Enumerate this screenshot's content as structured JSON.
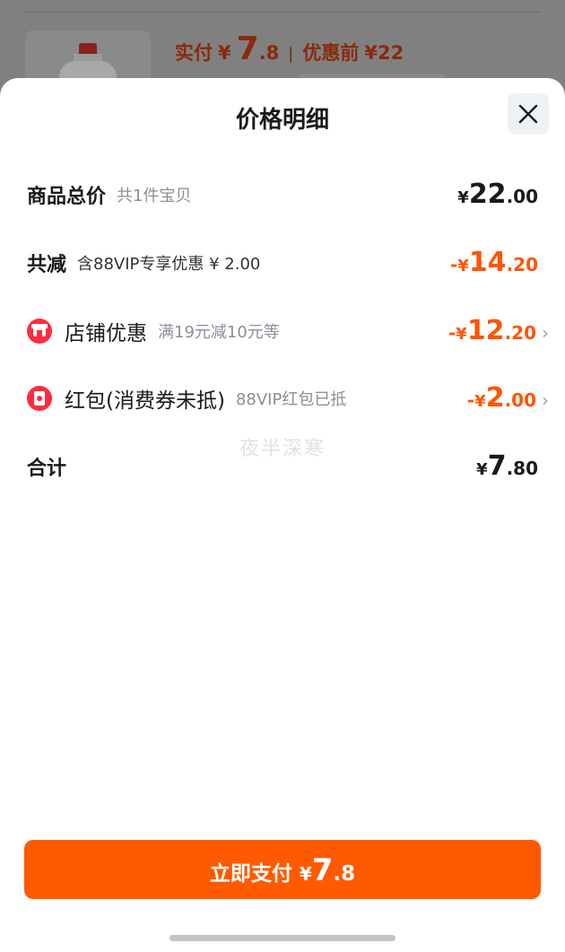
{
  "background": {
    "paid_label": "实付",
    "paid_currency": "¥",
    "paid_int": "7",
    "paid_dec": ".8",
    "separator": "|",
    "original_label": "优惠前",
    "original_price": "¥22"
  },
  "sheet": {
    "title": "价格明细",
    "rows": [
      {
        "label": "商品总价",
        "sub": "共1件宝贝",
        "sign": "",
        "currency": "¥",
        "int": "22",
        "dec": ".00"
      },
      {
        "label": "共减",
        "sub": "含88VIP专享优惠 ¥ 2.00",
        "sign": "-",
        "currency": "¥",
        "int": "14",
        "dec": ".20"
      },
      {
        "label": "店铺优惠",
        "sub": "满19元减10元等",
        "sign": "-",
        "currency": "¥",
        "int": "12",
        "dec": ".20"
      },
      {
        "label": "红包(消费券未抵)",
        "sub": "88VIP红包已抵",
        "sign": "-",
        "currency": "¥",
        "int": "2",
        "dec": ".00"
      },
      {
        "label": "合计",
        "sub": "",
        "sign": "",
        "currency": "¥",
        "int": "7",
        "dec": ".80"
      }
    ],
    "watermark": "夜半深寒"
  },
  "pay_button": {
    "label": "立即支付",
    "currency": "¥",
    "int": "7",
    "dec": ".8"
  },
  "icons": {
    "close": "close-icon",
    "store": "store-icon",
    "red_packet": "red-packet-icon",
    "chevron": "chevron-right-icon"
  },
  "colors": {
    "accent": "#ff5500",
    "button": "#ff5a00",
    "icon_red": "#ff2b3d",
    "text": "#1a1a1a",
    "muted": "#8a8f99"
  }
}
